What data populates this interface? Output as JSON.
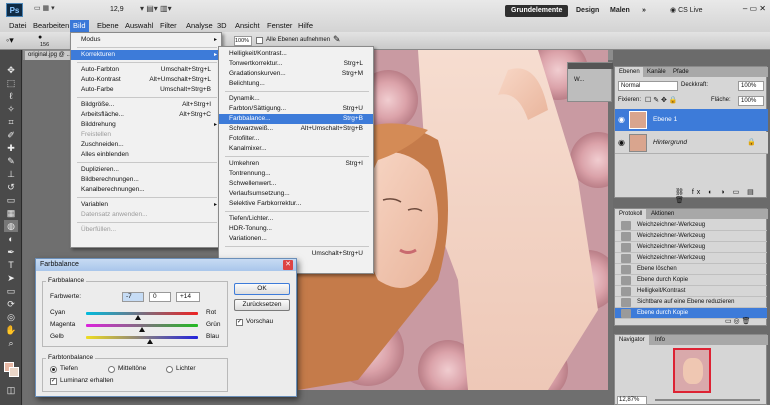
{
  "app": {
    "logo": "Ps",
    "zoom_top": "12,9",
    "workspace": [
      "Grundelemente",
      "Design",
      "Malen"
    ],
    "more": "»",
    "cs_live": "CS Live"
  },
  "menubar": [
    "Datei",
    "Bearbeiten",
    "Bild",
    "Ebene",
    "Auswahl",
    "Filter",
    "Analyse",
    "3D",
    "Ansicht",
    "Fenster",
    "Hilfe"
  ],
  "options": {
    "brush_size": "156",
    "zoom": "100%",
    "sample_all": "Alle Ebenen aufnehmen"
  },
  "document": {
    "tab": "original.jpg @ ..."
  },
  "bild_menu": [
    {
      "label": "Modus",
      "arrow": true
    },
    {
      "sep": true
    },
    {
      "label": "Korrekturen",
      "arrow": true,
      "hi": true
    },
    {
      "sep": true
    },
    {
      "label": "Auto-Farbton",
      "sc": "Umschalt+Strg+L"
    },
    {
      "label": "Auto-Kontrast",
      "sc": "Alt+Umschalt+Strg+L"
    },
    {
      "label": "Auto-Farbe",
      "sc": "Umschalt+Strg+B"
    },
    {
      "sep": true
    },
    {
      "label": "Bildgröße...",
      "sc": "Alt+Strg+I"
    },
    {
      "label": "Arbeitsfläche...",
      "sc": "Alt+Strg+C"
    },
    {
      "label": "Bilddrehung",
      "arrow": true
    },
    {
      "label": "Freistellen",
      "dis": true
    },
    {
      "label": "Zuschneiden..."
    },
    {
      "label": "Alles einblenden"
    },
    {
      "sep": true
    },
    {
      "label": "Duplizieren..."
    },
    {
      "label": "Bildberechnungen..."
    },
    {
      "label": "Kanalberechnungen..."
    },
    {
      "sep": true
    },
    {
      "label": "Variablen",
      "arrow": true
    },
    {
      "label": "Datensatz anwenden...",
      "dis": true
    },
    {
      "sep": true
    },
    {
      "label": "Überfüllen...",
      "dis": true
    }
  ],
  "korrekturen_menu": [
    {
      "label": "Helligkeit/Kontrast..."
    },
    {
      "label": "Tonwertkorrektur...",
      "sc": "Strg+L"
    },
    {
      "label": "Gradationskurven...",
      "sc": "Strg+M"
    },
    {
      "label": "Belichtung..."
    },
    {
      "sep": true
    },
    {
      "label": "Dynamik..."
    },
    {
      "label": "Farbton/Sättigung...",
      "sc": "Strg+U"
    },
    {
      "label": "Farbbalance...",
      "sc": "Strg+B",
      "hi": true
    },
    {
      "label": "Schwarzweiß...",
      "sc": "Alt+Umschalt+Strg+B"
    },
    {
      "label": "Fotofilter..."
    },
    {
      "label": "Kanalmixer..."
    },
    {
      "sep": true
    },
    {
      "label": "Umkehren",
      "sc": "Strg+I"
    },
    {
      "label": "Tontrennung..."
    },
    {
      "label": "Schwellenwert..."
    },
    {
      "label": "Verlaufsumsetzung..."
    },
    {
      "label": "Selektive Farbkorrektur..."
    },
    {
      "sep": true
    },
    {
      "label": "Tiefen/Lichter..."
    },
    {
      "label": "HDR-Tonung..."
    },
    {
      "label": "Variationen..."
    },
    {
      "sep": true
    },
    {
      "label": "",
      "sc": "Umschalt+Strg+U"
    }
  ],
  "dialog": {
    "title": "Farbbalance",
    "group1": "Farbbalance",
    "values_label": "Farbwerte:",
    "values": [
      "-7",
      "0",
      "+14"
    ],
    "sliders": [
      {
        "left": "Cyan",
        "right": "Rot",
        "value": -7
      },
      {
        "left": "Magenta",
        "right": "Grün",
        "value": 0
      },
      {
        "left": "Gelb",
        "right": "Blau",
        "value": 14
      }
    ],
    "group2": "Farbtonbalance",
    "tones": [
      "Tiefen",
      "Mitteltöne",
      "Lichter"
    ],
    "selected_tone": "Tiefen",
    "luminance": "Luminanz erhalten",
    "ok": "OK",
    "reset": "Zurücksetzen",
    "preview": "Vorschau"
  },
  "mini_panel": {
    "label": "W..."
  },
  "layers_panel": {
    "tabs": [
      "Ebenen",
      "Kanäle",
      "Pfade"
    ],
    "blend": "Normal",
    "opacity_label": "Deckkraft:",
    "opacity": "100%",
    "lock_label": "Fixieren:",
    "fill_label": "Fläche:",
    "fill": "100%",
    "layers": [
      {
        "name": "Ebene 1",
        "selected": true
      },
      {
        "name": "Hintergrund",
        "selected": false
      }
    ]
  },
  "history_panel": {
    "tabs": [
      "Protokoll",
      "Aktionen"
    ],
    "items": [
      "Weichzeichner-Werkzeug",
      "Weichzeichner-Werkzeug",
      "Weichzeichner-Werkzeug",
      "Weichzeichner-Werkzeug",
      "Ebene löschen",
      "Ebene durch Kopie",
      "Helligkeit/Kontrast",
      "Sichtbare auf eine Ebene reduzieren",
      "Ebene durch Kopie"
    ]
  },
  "navigator": {
    "tabs": [
      "Navigator",
      "Info"
    ],
    "zoom": "12,87%"
  },
  "colors": {
    "accent": "#3d7bd9"
  }
}
